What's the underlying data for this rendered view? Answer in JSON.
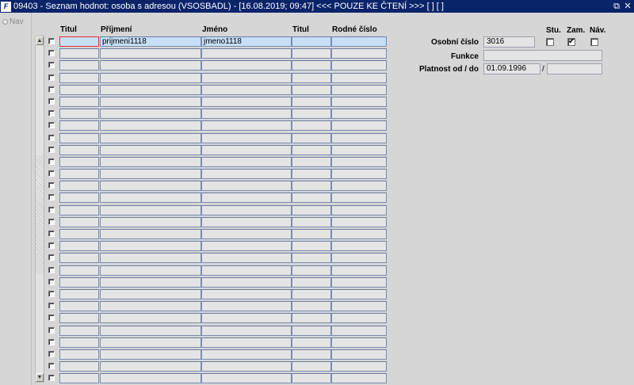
{
  "window": {
    "title": "09403 - Seznam hodnot: osoba s adresou (VSOSBADL) - [16.08.2019; 09:47] <<< POUZE KE ČTENÍ >>>  [ ]  [ ]",
    "app_icon": "F",
    "restore_glyph": "⧉",
    "close_glyph": "✕"
  },
  "nav": {
    "label": "Nav"
  },
  "grid": {
    "headers": {
      "titul": "Titul",
      "prijmeni": "Příjmení",
      "jmeno": "Jméno",
      "titul2": "Titul",
      "rodne_cislo": "Rodné číslo"
    },
    "first_row": {
      "titul": "",
      "prijmeni": "prijmeni1118",
      "jmeno": "jmeno1118",
      "titul2": "",
      "rodne_cislo": ""
    },
    "row_count": 29
  },
  "detail": {
    "check_headers": {
      "stu": "Stu.",
      "zam": "Zam.",
      "nav": "Náv."
    },
    "checks": {
      "stu": false,
      "zam": true,
      "nav": false
    },
    "osobni_cislo_label": "Osobní číslo",
    "osobni_cislo_value": "3016",
    "funkce_label": "Funkce",
    "funkce_value": "",
    "platnost_label": "Platnost od / do",
    "platnost_od": "01.09.1996",
    "platnost_separator": "/",
    "platnost_do": ""
  },
  "colors": {
    "titlebar": "#0a246a",
    "active_row": "#c6dff7",
    "focus_border": "#e23030"
  }
}
